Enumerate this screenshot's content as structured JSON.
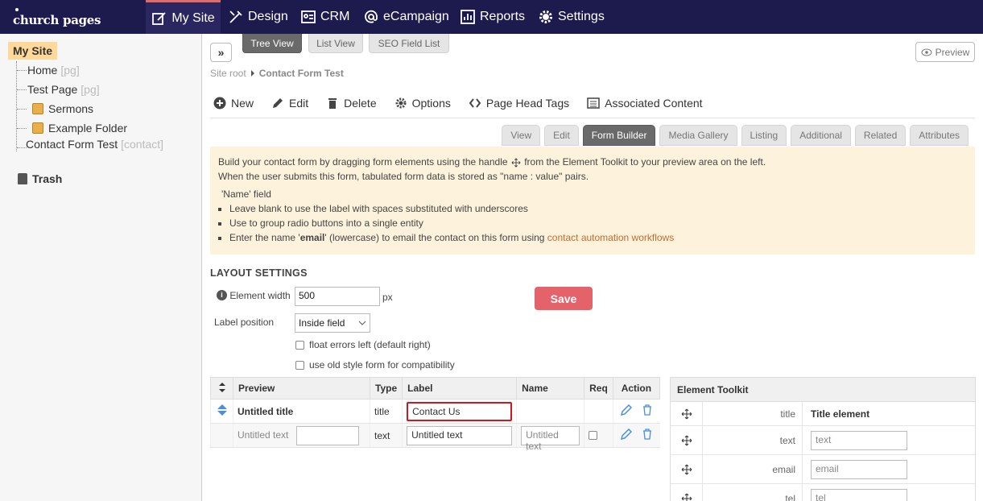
{
  "brand": {
    "logo_text": "church pages"
  },
  "topnav": {
    "items": [
      {
        "label": "My Site",
        "icon": "edit-icon",
        "active": true
      },
      {
        "label": "Design",
        "icon": "design-icon"
      },
      {
        "label": "CRM",
        "icon": "contacts-icon"
      },
      {
        "label": "eCampaign",
        "icon": "at-icon"
      },
      {
        "label": "Reports",
        "icon": "chart-icon"
      },
      {
        "label": "Settings",
        "icon": "gear-icon"
      }
    ]
  },
  "sidebar": {
    "root": "My Site",
    "items": [
      {
        "label": "Home",
        "tag": "[pg]"
      },
      {
        "label": "Test Page",
        "tag": "[pg]"
      },
      {
        "label": "Sermons",
        "tag": ""
      },
      {
        "label": "Example Folder",
        "tag": ""
      },
      {
        "label": "Contact Form Test",
        "tag": "[contact]"
      }
    ],
    "trash": "Trash"
  },
  "viewtabs": [
    "Tree View",
    "List View",
    "SEO Field List"
  ],
  "preview_label": "Preview",
  "breadcrumb": {
    "root": "Site root",
    "current": "Contact Form Test"
  },
  "toolbar": {
    "new": "New",
    "edit": "Edit",
    "delete": "Delete",
    "options": "Options",
    "page_head_tags": "Page Head Tags",
    "associated_content": "Associated Content"
  },
  "subtabs": [
    "View",
    "Edit",
    "Form Builder",
    "Media Gallery",
    "Listing",
    "Additional",
    "Related",
    "Attributes"
  ],
  "info": {
    "line1a": "Build your contact form by dragging form elements using the handle",
    "line1b": "from the Element Toolkit to your preview area on the left.",
    "line2": "When the user submits this form, tabulated form data is stored as \"name : value\" pairs.",
    "name_field": "'Name' field",
    "bullet1": "Leave blank to use the label with spaces substituted with underscores",
    "bullet2": "Use to group radio buttons into a single entity",
    "bullet3a": "Enter the name '",
    "bullet3b": "email",
    "bullet3c": "' (lowercase) to email the contact on this form using",
    "bullet3link": "contact automation workflows"
  },
  "layout": {
    "title": "LAYOUT SETTINGS",
    "element_width_label": "Element width",
    "element_width_value": "500",
    "px": "px",
    "label_position_label": "Label position",
    "label_position_value": "Inside field",
    "float_errors": "float errors left (default right)",
    "old_style": "use old style form for compatibility",
    "save": "Save"
  },
  "form_table": {
    "headers": [
      "Preview",
      "Type",
      "Label",
      "Name",
      "Req",
      "Action"
    ],
    "rows": [
      {
        "preview": "Untitled title",
        "type": "title",
        "label": "Contact Us",
        "name": ""
      },
      {
        "preview": "Untitled text",
        "type": "text",
        "label": "Untitled text",
        "name_placeholder": "Untitled text"
      }
    ]
  },
  "toolkit": {
    "title": "Element Toolkit",
    "rows": [
      {
        "name": "title",
        "value": "Title element"
      },
      {
        "name": "text",
        "placeholder": "text"
      },
      {
        "name": "email",
        "placeholder": "email"
      },
      {
        "name": "tel",
        "placeholder": "tel"
      }
    ]
  }
}
